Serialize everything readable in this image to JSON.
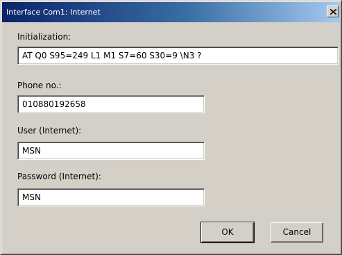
{
  "window": {
    "title": "Interface Com1: Internet"
  },
  "form": {
    "initialization": {
      "label": "Initialization:",
      "value": "AT Q0 S95=249 L1 M1 S7=60 S30=9 \\N3 ?"
    },
    "phone": {
      "label": "Phone no.:",
      "value": "010880192658"
    },
    "user": {
      "label": "User (Internet):",
      "value": "MSN"
    },
    "password": {
      "label": "Password (Internet):",
      "value": "MSN"
    }
  },
  "buttons": {
    "ok_label": "OK",
    "cancel_label": "Cancel"
  }
}
